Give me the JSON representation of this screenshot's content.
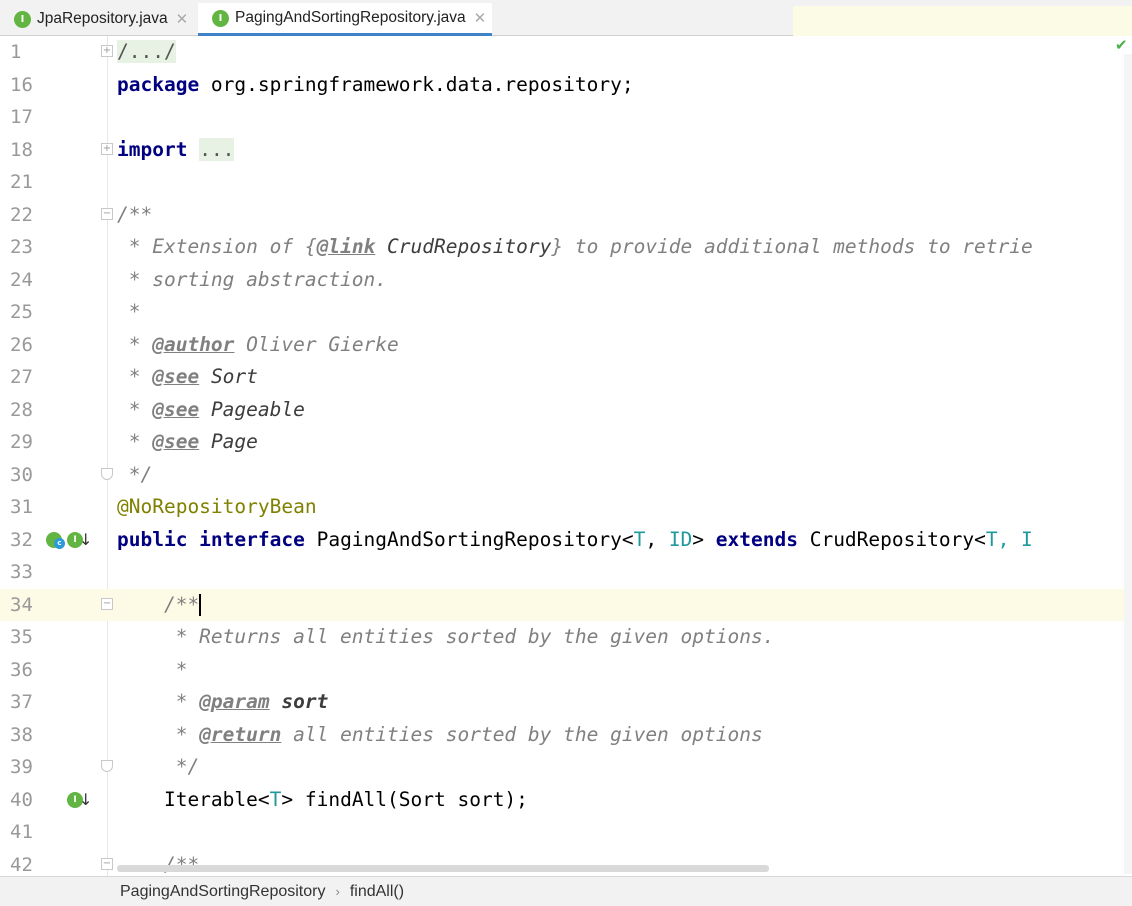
{
  "tabs": [
    {
      "label": "JpaRepository.java",
      "icon": "interface-icon",
      "active": false
    },
    {
      "label": "PagingAndSortingRepository.java",
      "icon": "interface-icon",
      "active": true
    }
  ],
  "gutter_icon_letter": "I",
  "lines": [
    {
      "n": "1"
    },
    {
      "n": "16"
    },
    {
      "n": "17"
    },
    {
      "n": "18"
    },
    {
      "n": "21"
    },
    {
      "n": "22"
    },
    {
      "n": "23"
    },
    {
      "n": "24"
    },
    {
      "n": "25"
    },
    {
      "n": "26"
    },
    {
      "n": "27"
    },
    {
      "n": "28"
    },
    {
      "n": "29"
    },
    {
      "n": "30"
    },
    {
      "n": "31"
    },
    {
      "n": "32"
    },
    {
      "n": "33"
    },
    {
      "n": "34"
    },
    {
      "n": "35"
    },
    {
      "n": "36"
    },
    {
      "n": "37"
    },
    {
      "n": "38"
    },
    {
      "n": "39"
    },
    {
      "n": "40"
    },
    {
      "n": "41"
    },
    {
      "n": "42"
    }
  ],
  "code": {
    "l1": "/.../",
    "l16_kw": "package",
    "l16_rest": " org.springframework.data.repository;",
    "l18_kw": "import",
    "l18_folded": "...",
    "l22": "/**",
    "l23_a": " * Extension of {",
    "l23_tag": "@link",
    "l23_ref": " CrudRepository",
    "l23_b": "} to provide additional methods to retrie",
    "l24": " * sorting abstraction.",
    "l25": " *",
    "l26_a": " * ",
    "l26_tag": "@author",
    "l26_b": " Oliver Gierke",
    "l27_tag": "@see",
    "l27_ref": " Sort",
    "l28_tag": "@see",
    "l28_ref": " Pageable",
    "l29_tag": "@see",
    "l29_ref": " Page",
    "l30": " */",
    "l31": "@NoRepositoryBean",
    "l32_kw1": "public interface",
    "l32_name": " PagingAndSortingRepository<",
    "l32_t": "T",
    "l32_comma": ", ",
    "l32_id": "ID",
    "l32_gt": "> ",
    "l32_kw2": "extends",
    "l32_crud": " CrudRepository<",
    "l32_t2": "T",
    "l32_tail": ", I",
    "l34": "    /**",
    "l35": "     * Returns all entities sorted by the given options.",
    "l36": "     *",
    "l37_a": "     * ",
    "l37_tag": "@param",
    "l37_p": " sort",
    "l38_a": "     * ",
    "l38_tag": "@return",
    "l38_b": " all entities sorted by the given options",
    "l39": "     */",
    "l40_a": "    Iterable<",
    "l40_t": "T",
    "l40_b": "> findAll(Sort sort);",
    "l42": "    /**",
    "star_prefix": " * "
  },
  "breadcrumb": {
    "class": "PagingAndSortingRepository",
    "method": "findAll()",
    "separator": "›"
  },
  "colors": {
    "keyword": "#000080",
    "comment": "#808080",
    "type_param": "#20999d",
    "annotation": "#808000",
    "current_line": "#fdfbe6",
    "tab_underline": "#4083c9"
  }
}
